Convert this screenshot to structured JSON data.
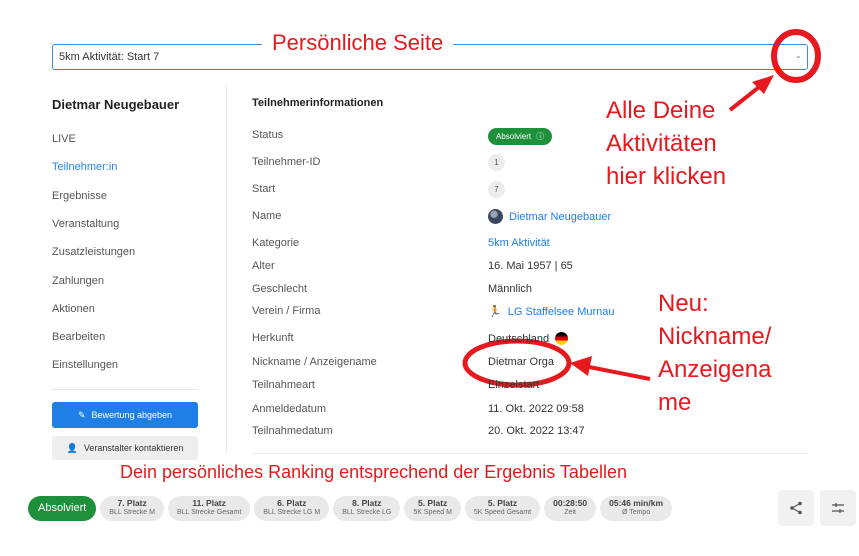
{
  "activity_select": {
    "value": "5km Aktivität: Start 7"
  },
  "annotations": {
    "title": "Persönliche Seite",
    "activities": "Alle Deine\nAktivitäten\nhier klicken",
    "nickname": "Neu:\nNickname/\nAnzeigena\nme",
    "ranking": "Dein persönliches Ranking entsprechend der Ergebnis Tabellen"
  },
  "sidebar": {
    "name": "Dietmar Neugebauer",
    "items": [
      {
        "label": "LIVE"
      },
      {
        "label": "Teilnehmer:in"
      },
      {
        "label": "Ergebnisse"
      },
      {
        "label": "Veranstaltung"
      },
      {
        "label": "Zusatzleistungen"
      },
      {
        "label": "Zahlungen"
      },
      {
        "label": "Aktionen"
      },
      {
        "label": "Bearbeiten"
      },
      {
        "label": "Einstellungen"
      }
    ],
    "rate_button": "Bewertung abgeben",
    "contact_button": "Veranstalter kontaktieren"
  },
  "details": {
    "title": "Teilnehmerinformationen",
    "labels": {
      "status": "Status",
      "id": "Teilnehmer-ID",
      "start": "Start",
      "name": "Name",
      "category": "Kategorie",
      "age": "Alter",
      "gender": "Geschlecht",
      "club": "Verein / Firma",
      "origin": "Herkunft",
      "nickname": "Nickname / Anzeigename",
      "type": "Teilnahmeart",
      "registration": "Anmeldedatum",
      "participation": "Teilnahmedatum"
    },
    "values": {
      "status": "Absolviert",
      "id": "1",
      "start": "7",
      "name": "Dietmar Neugebauer",
      "category": "5km Aktivität",
      "age": "16. Mai 1957 | 65",
      "gender": "Männlich",
      "club": "LG Staffelsee Murnau",
      "origin": "Deutschland",
      "nickname": "Dietmar Orga",
      "type": "Einzelstart",
      "registration": "11. Okt. 2022 09:58",
      "participation": "20. Okt. 2022 13:47"
    }
  },
  "ranking_bar": {
    "status": "Absolviert",
    "chips": [
      {
        "main": "7. Platz",
        "sub": "BLL Strecke M"
      },
      {
        "main": "11. Platz",
        "sub": "BLL Strecke Gesamt"
      },
      {
        "main": "6. Platz",
        "sub": "BLL Strecke LG M"
      },
      {
        "main": "8. Platz",
        "sub": "BLL Strecke LG"
      },
      {
        "main": "5. Platz",
        "sub": "5K Speed M"
      },
      {
        "main": "5. Platz",
        "sub": "5K Speed Gesamt"
      },
      {
        "main": "00:28:50",
        "sub": "Zeit"
      },
      {
        "main": "05:46 min/km",
        "sub": "Ø Tempo"
      }
    ]
  },
  "colors": {
    "accent": "#1f7fe6",
    "success": "#1e8f3a",
    "annotation": "#e6191f"
  },
  "icons": [
    "chevron-down-icon",
    "info-icon",
    "avatar",
    "runners-icon",
    "flag-germany-icon",
    "edit-icon",
    "user-add-icon",
    "share-icon",
    "filter-icon"
  ]
}
